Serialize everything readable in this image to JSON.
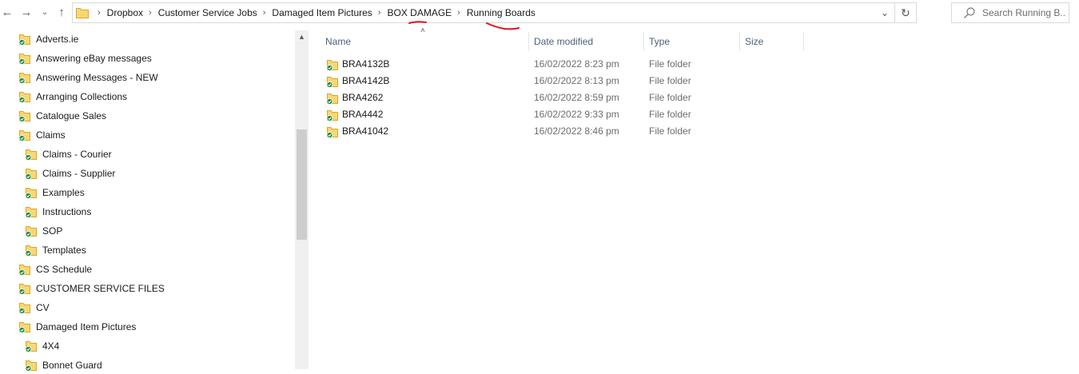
{
  "toolbar": {
    "back_icon": "arrow-left-icon",
    "forward_icon": "arrow-right-icon",
    "recent_icon": "chevron-down-icon",
    "up_icon": "arrow-up-icon"
  },
  "breadcrumb": [
    "Dropbox",
    "Customer Service Jobs",
    "Damaged Item Pictures",
    "BOX DAMAGE",
    "Running Boards"
  ],
  "search": {
    "placeholder": "Search Running B..."
  },
  "sidebar": {
    "items": [
      {
        "label": "Adverts.ie",
        "level": 0
      },
      {
        "label": "Answering eBay messages",
        "level": 0
      },
      {
        "label": "Answering Messages - NEW",
        "level": 0
      },
      {
        "label": "Arranging Collections",
        "level": 0
      },
      {
        "label": "Catalogue Sales",
        "level": 0
      },
      {
        "label": "Claims",
        "level": 0
      },
      {
        "label": "Claims - Courier",
        "level": 1
      },
      {
        "label": "Claims - Supplier",
        "level": 1
      },
      {
        "label": "Examples",
        "level": 1
      },
      {
        "label": "Instructions",
        "level": 1
      },
      {
        "label": "SOP",
        "level": 1
      },
      {
        "label": "Templates",
        "level": 1
      },
      {
        "label": "CS Schedule",
        "level": 0
      },
      {
        "label": "CUSTOMER SERVICE FILES",
        "level": 0
      },
      {
        "label": "CV",
        "level": 0
      },
      {
        "label": "Damaged Item Pictures",
        "level": 0
      },
      {
        "label": "4X4",
        "level": 1
      },
      {
        "label": "Bonnet Guard",
        "level": 1
      }
    ]
  },
  "columns": {
    "name": "Name",
    "date": "Date modified",
    "type": "Type",
    "size": "Size"
  },
  "files": [
    {
      "name": "BRA4132B",
      "date": "16/02/2022 8:23 pm",
      "type": "File folder"
    },
    {
      "name": "BRA4142B",
      "date": "16/02/2022 8:13 pm",
      "type": "File folder"
    },
    {
      "name": "BRA4262",
      "date": "16/02/2022 8:59 pm",
      "type": "File folder"
    },
    {
      "name": "BRA4442",
      "date": "16/02/2022 9:33 pm",
      "type": "File folder"
    },
    {
      "name": "BRA41042",
      "date": "16/02/2022 8:46 pm",
      "type": "File folder"
    }
  ],
  "colors": {
    "folder": "#f8d775",
    "sync_check": "#1e8a3a",
    "annotation": "#e0141c",
    "header_text": "#4c607a"
  }
}
